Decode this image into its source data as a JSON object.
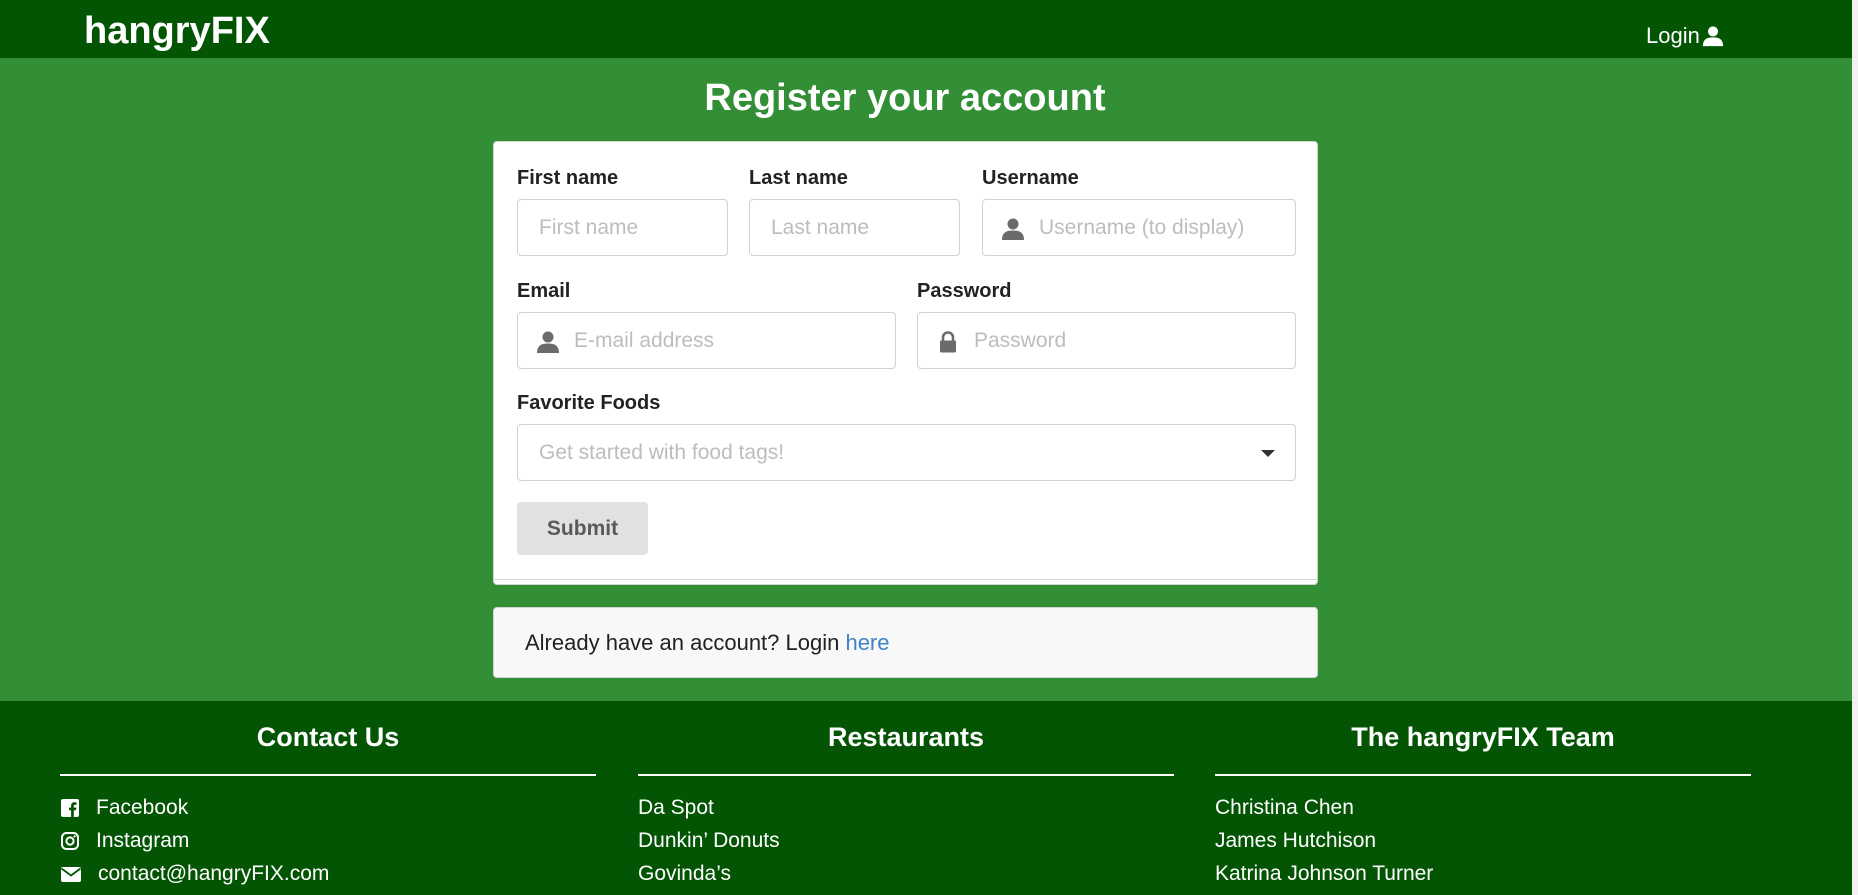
{
  "navbar": {
    "brand": "hangryFIX",
    "login_label": "Login",
    "icons": {
      "login": "user-icon"
    }
  },
  "page": {
    "title": "Register your account"
  },
  "form": {
    "first_name": {
      "label": "First name",
      "placeholder": "First name",
      "value": ""
    },
    "last_name": {
      "label": "Last name",
      "placeholder": "Last name",
      "value": ""
    },
    "username": {
      "label": "Username",
      "placeholder": "Username (to display)",
      "value": "",
      "icon": "user-icon"
    },
    "email": {
      "label": "Email",
      "placeholder": "E-mail address",
      "value": "",
      "icon": "user-icon"
    },
    "password": {
      "label": "Password",
      "placeholder": "Password",
      "value": "",
      "icon": "lock-icon"
    },
    "favorite_foods": {
      "label": "Favorite Foods",
      "placeholder": "Get started with food tags!",
      "icon": "caret-down-icon"
    },
    "submit_label": "Submit"
  },
  "login_prompt": {
    "text": "Already have an account? Login ",
    "link_label": "here"
  },
  "footer": {
    "contact": {
      "title": "Contact Us",
      "items": [
        {
          "label": "Facebook",
          "icon": "facebook-icon"
        },
        {
          "label": "Instagram",
          "icon": "instagram-icon"
        },
        {
          "label": "contact@hangryFIX.com",
          "icon": "envelope-icon"
        }
      ]
    },
    "restaurants": {
      "title": "Restaurants",
      "items": [
        "Da Spot",
        "Dunkin’ Donuts",
        "Govinda’s"
      ]
    },
    "team": {
      "title": "The hangryFIX Team",
      "items": [
        "Christina Chen",
        "James Hutchison",
        "Katrina Johnson Turner"
      ]
    }
  },
  "colors": {
    "navbar": "#035504",
    "page_background": "#338f35",
    "link": "#4183c4",
    "button": "#e0e1e2"
  }
}
